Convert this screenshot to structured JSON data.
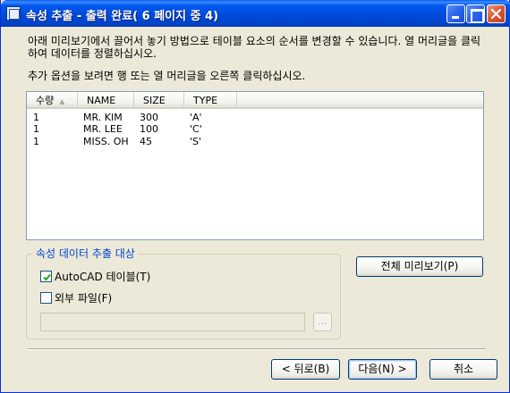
{
  "window": {
    "title": "속성 추출 - 출력 완료( 6 페이지 중 4)"
  },
  "instructions": {
    "line1": "아래 미리보기에서 끌어서 놓기 방법으로 테이블 요소의 순서를 변경할 수 있습니다. 열 머리글을 클릭하여 데이터를 정렬하십시오.",
    "line2": "추가 옵션을 보려면 행 또는 열 머리글을 오른쪽 클릭하십시오."
  },
  "table": {
    "columns": [
      "수량",
      "NAME",
      "SIZE",
      "TYPE"
    ],
    "sort_indicator": "▲",
    "rows": [
      [
        "1",
        "MR. KIM",
        "300",
        "'A'"
      ],
      [
        "1",
        "MR. LEE",
        "100",
        "'C'"
      ],
      [
        "1",
        "MISS. OH",
        "45",
        "'S'"
      ]
    ]
  },
  "output_group": {
    "title": "속성 데이터 추출 대상",
    "autocad_table_label": "AutoCAD 테이블(T)",
    "autocad_table_checked": true,
    "external_file_label": "외부 파일(F)",
    "external_file_checked": false,
    "file_path_value": "",
    "browse_label": "..."
  },
  "buttons": {
    "full_preview": "전체 미리보기(P)",
    "back": "< 뒤로(B)",
    "next": "다음(N) >",
    "cancel": "취소"
  },
  "colors": {
    "titlebar": "#0058ee",
    "group_title": "#0046d5",
    "close_button": "#dc5530"
  }
}
